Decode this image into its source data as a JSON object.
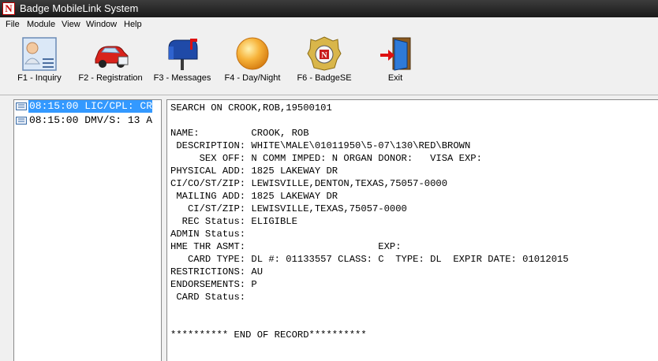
{
  "window": {
    "title": "Badge MobileLink System",
    "app_icon_glyph": "N"
  },
  "menu": [
    "File",
    "Module",
    "View",
    "Window",
    "Help"
  ],
  "toolbar": [
    {
      "label": "F1 - Inquiry",
      "icon": "person-document-icon"
    },
    {
      "label": "F2 -  Registration",
      "icon": "car-icon"
    },
    {
      "label": "F3 - Messages",
      "icon": "mailbox-icon"
    },
    {
      "label": "F4 - Day/Night",
      "icon": "sun-icon"
    },
    {
      "label": "F6 - BadgeSE",
      "icon": "badge-icon"
    },
    {
      "label": "Exit",
      "icon": "exit-door-icon"
    }
  ],
  "tree": [
    {
      "text": "08:15:00 LIC/CPL: CR",
      "selected": true
    },
    {
      "text": "08:15:00 DMV/S: 13 A",
      "selected": false
    }
  ],
  "record": [
    "SEARCH ON CROOK,ROB,19500101",
    "",
    "NAME:         CROOK, ROB",
    " DESCRIPTION: WHITE\\MALE\\01011950\\5-07\\130\\RED\\BROWN",
    "     SEX OFF: N COMM IMPED: N ORGAN DONOR:   VISA EXP:",
    "PHYSICAL ADD: 1825 LAKEWAY DR",
    "CI/CO/ST/ZIP: LEWISVILLE,DENTON,TEXAS,75057-0000",
    " MAILING ADD: 1825 LAKEWAY DR",
    "   CI/ST/ZIP: LEWISVILLE,TEXAS,75057-0000",
    "  REC Status: ELIGIBLE",
    "ADMIN Status:",
    "HME THR ASMT:                       EXP:",
    "   CARD TYPE: DL #: 01133557 CLASS: C  TYPE: DL  EXPIR DATE: 01012015",
    "RESTRICTIONS: AU",
    "ENDORSEMENTS: P",
    " CARD Status:",
    "",
    "",
    "********** END OF RECORD**********"
  ]
}
